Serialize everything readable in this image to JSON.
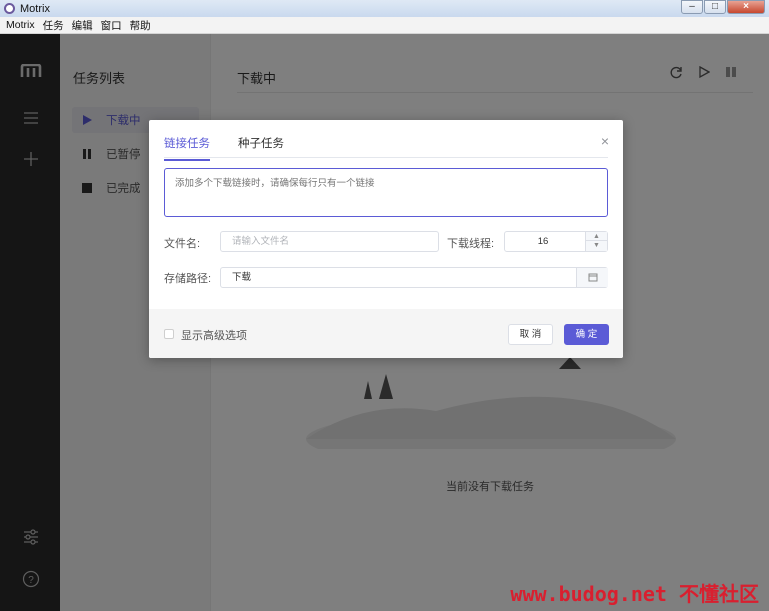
{
  "window": {
    "title": "Motrix",
    "controls": {
      "minimize": "–",
      "maximize": "□",
      "close": "×"
    }
  },
  "menu": [
    "Motrix",
    "任务",
    "编辑",
    "窗口",
    "帮助"
  ],
  "sidebar": {
    "icons": [
      "logo-icon",
      "menu-icon",
      "plus-icon",
      "settings-icon",
      "help-icon"
    ]
  },
  "tasklist": {
    "title": "任务列表",
    "items": [
      {
        "label": "下载中",
        "icon": "play-icon",
        "active": true
      },
      {
        "label": "已暂停",
        "icon": "pause-icon",
        "active": false
      },
      {
        "label": "已完成",
        "icon": "stop-icon",
        "active": false
      }
    ]
  },
  "main": {
    "title": "下载中",
    "toolbar": [
      "refresh-icon",
      "resume-icon",
      "pause-all-icon"
    ],
    "empty_text": "当前没有下载任务"
  },
  "dialog": {
    "tabs": [
      {
        "label": "链接任务",
        "active": true
      },
      {
        "label": "种子任务",
        "active": false
      }
    ],
    "urls_placeholder": "添加多个下载链接时，请确保每行只有一个链接",
    "filename_label": "文件名:",
    "filename_placeholder": "请输入文件名",
    "threads_label": "下载线程:",
    "threads_value": "16",
    "path_label": "存储路径:",
    "path_value": "下载",
    "advanced_label": "显示高级选项",
    "cancel_label": "取 消",
    "ok_label": "确 定"
  },
  "watermark": "www.budog.net 不懂社区",
  "colors": {
    "accent": "#5b5bd6",
    "sidebar": "#2b2b2b",
    "watermark": "#d91f2f"
  }
}
